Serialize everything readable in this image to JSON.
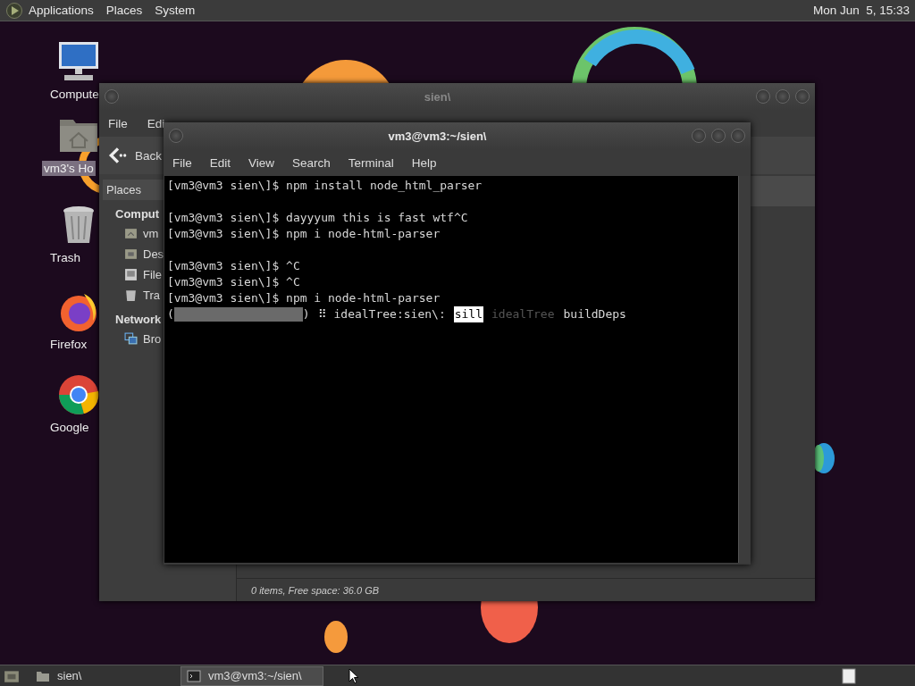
{
  "top_panel": {
    "menus": [
      "Applications",
      "Places",
      "System"
    ],
    "clock": "Mon Jun  5, 15:33"
  },
  "desktop_icons": [
    {
      "label": "Compute",
      "kind": "computer",
      "selected": false
    },
    {
      "label": "vm3's Ho",
      "kind": "home",
      "selected": true
    },
    {
      "label": "Trash",
      "kind": "trash",
      "selected": false
    },
    {
      "label": "Firefox",
      "kind": "firefox",
      "selected": false
    },
    {
      "label": "Google",
      "kind": "chrome",
      "selected": false
    }
  ],
  "file_manager": {
    "title": "sien\\",
    "menu": [
      "File",
      "Edi"
    ],
    "back_label": "Back",
    "sidebar": {
      "header": "Places",
      "sections": [
        {
          "heading": "Comput",
          "items": [
            {
              "label": "vm",
              "kind": "home"
            },
            {
              "label": "Des",
              "kind": "desktop"
            },
            {
              "label": "File",
              "kind": "drive"
            },
            {
              "label": "Tra",
              "kind": "trash"
            }
          ]
        },
        {
          "heading": "Network",
          "items": [
            {
              "label": "Bro",
              "kind": "network"
            }
          ]
        }
      ]
    },
    "status": "0 items, Free space: 36.0 GB"
  },
  "terminal": {
    "title": "vm3@vm3:~/sien\\",
    "menu": [
      "File",
      "Edit",
      "View",
      "Search",
      "Terminal",
      "Help"
    ],
    "lines": [
      {
        "kind": "text",
        "text": "[vm3@vm3 sien\\]$ npm install node_html_parser"
      },
      {
        "kind": "blank"
      },
      {
        "kind": "text",
        "text": "[vm3@vm3 sien\\]$ dayyyum this is fast wtf^C"
      },
      {
        "kind": "text",
        "text": "[vm3@vm3 sien\\]$ npm i node-html-parser"
      },
      {
        "kind": "blank"
      },
      {
        "kind": "text",
        "text": "[vm3@vm3 sien\\]$ ^C"
      },
      {
        "kind": "text",
        "text": "[vm3@vm3 sien\\]$ ^C"
      },
      {
        "kind": "text",
        "text": "[vm3@vm3 sien\\]$ npm i node-html-parser"
      },
      {
        "kind": "progress",
        "open": "(",
        "close": ")",
        "level": 1,
        "segments": [
          {
            "kind": "plain",
            "text": "⠿ idealTree:sien\\:"
          },
          {
            "kind": "highlight",
            "text": "sill"
          },
          {
            "kind": "dim",
            "text": "idealTree"
          },
          {
            "kind": "plain",
            "text": "buildDeps"
          }
        ]
      }
    ]
  },
  "taskbar": {
    "items": [
      {
        "label": "sien\\",
        "kind": "folder",
        "selected": false
      },
      {
        "label": "vm3@vm3:~/sien\\",
        "kind": "terminal",
        "selected": true
      }
    ]
  }
}
